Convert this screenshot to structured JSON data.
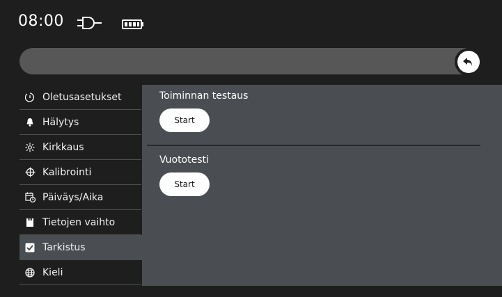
{
  "status": {
    "time": "08:00",
    "icons": [
      "plug-icon",
      "battery-icon"
    ]
  },
  "sidebar": {
    "items": [
      {
        "label": "Oletusasetukset",
        "icon": "clock-reset-icon"
      },
      {
        "label": "Hälytys",
        "icon": "bell-icon"
      },
      {
        "label": "Kirkkaus",
        "icon": "brightness-icon"
      },
      {
        "label": "Kalibrointi",
        "icon": "crosshair-icon"
      },
      {
        "label": "Päiväys/Aika",
        "icon": "calendar-clock-icon"
      },
      {
        "label": "Tietojen vaihto",
        "icon": "sd-card-icon"
      },
      {
        "label": "Tarkistus",
        "icon": "checkbox-icon",
        "active": true
      },
      {
        "label": "Kieli",
        "icon": "globe-icon"
      }
    ]
  },
  "main": {
    "sections": [
      {
        "title": "Toiminnan testaus",
        "button_label": "Start"
      },
      {
        "title": "Vuototesti",
        "button_label": "Start"
      }
    ]
  },
  "colors": {
    "background": "#1e1e1e",
    "panel": "#4a4e52",
    "topbar": "#575757",
    "button": "#ffffff"
  }
}
